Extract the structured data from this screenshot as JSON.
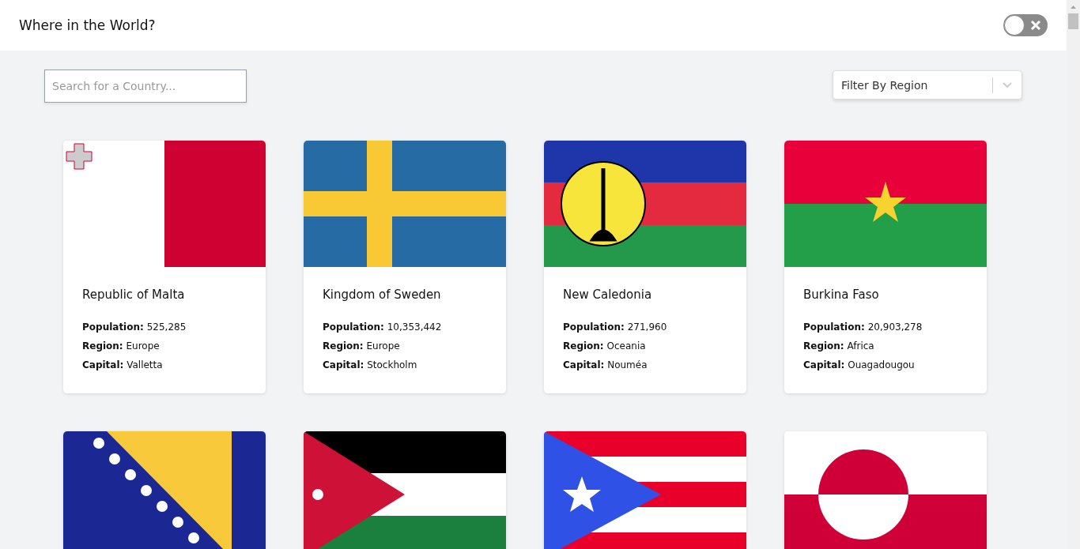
{
  "header": {
    "title": "Where in the World?",
    "theme_toggle": {
      "on": false
    }
  },
  "search": {
    "placeholder": "Search for a Country..."
  },
  "filter": {
    "label": "Filter By Region"
  },
  "countries": [
    {
      "kind": "malta",
      "name": "Republic of Malta",
      "details": [
        {
          "label": "Population:",
          "value": "525,285"
        },
        {
          "label": "Region:",
          "value": "Europe"
        },
        {
          "label": "Capital:",
          "value": "Valletta"
        }
      ]
    },
    {
      "kind": "sweden",
      "name": "Kingdom of Sweden",
      "details": [
        {
          "label": "Population:",
          "value": "10,353,442"
        },
        {
          "label": "Region:",
          "value": "Europe"
        },
        {
          "label": "Capital:",
          "value": "Stockholm"
        }
      ]
    },
    {
      "kind": "new-caledonia",
      "name": "New Caledonia",
      "details": [
        {
          "label": "Population:",
          "value": "271,960"
        },
        {
          "label": "Region:",
          "value": "Oceania"
        },
        {
          "label": "Capital:",
          "value": "Nouméa"
        }
      ]
    },
    {
      "kind": "burkina-faso",
      "name": "Burkina Faso",
      "details": [
        {
          "label": "Population:",
          "value": "20,903,278"
        },
        {
          "label": "Region:",
          "value": "Africa"
        },
        {
          "label": "Capital:",
          "value": "Ouagadougou"
        }
      ]
    },
    {
      "kind": "bosnia"
    },
    {
      "kind": "jordan"
    },
    {
      "kind": "puerto-rico"
    },
    {
      "kind": "greenland"
    }
  ]
}
